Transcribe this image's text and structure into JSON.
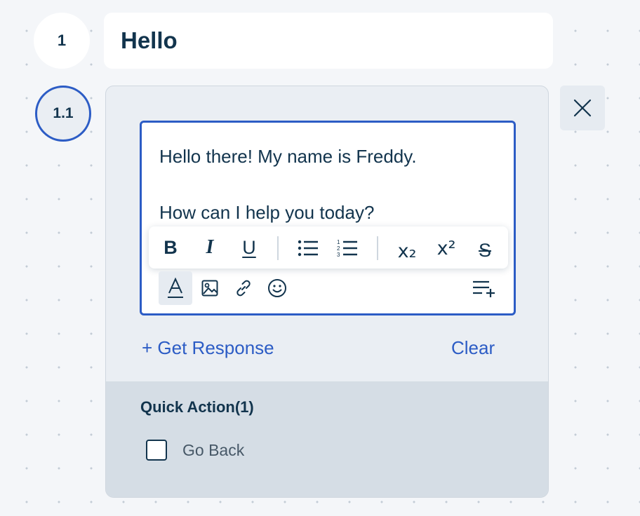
{
  "steps": [
    {
      "number": "1",
      "title": "Hello"
    },
    {
      "number": "1.1"
    }
  ],
  "editor": {
    "line1": "Hello there! My name is Freddy.",
    "line2": "How can I help you today?"
  },
  "toolbar": {
    "bold": "B",
    "italic": "I",
    "underline": "U",
    "subscript": "x₂",
    "superscript": "x²",
    "strikethrough": "S"
  },
  "actions": {
    "get_response": "+ Get Response",
    "clear": "Clear"
  },
  "quick_actions": {
    "title": "Quick Action(1)",
    "items": [
      {
        "label": "Go Back",
        "checked": false
      }
    ]
  },
  "colors": {
    "accent": "#2c5cc5",
    "text": "#12344d",
    "panel": "#eaeef3",
    "quick_action_bg": "#d5dde5"
  }
}
